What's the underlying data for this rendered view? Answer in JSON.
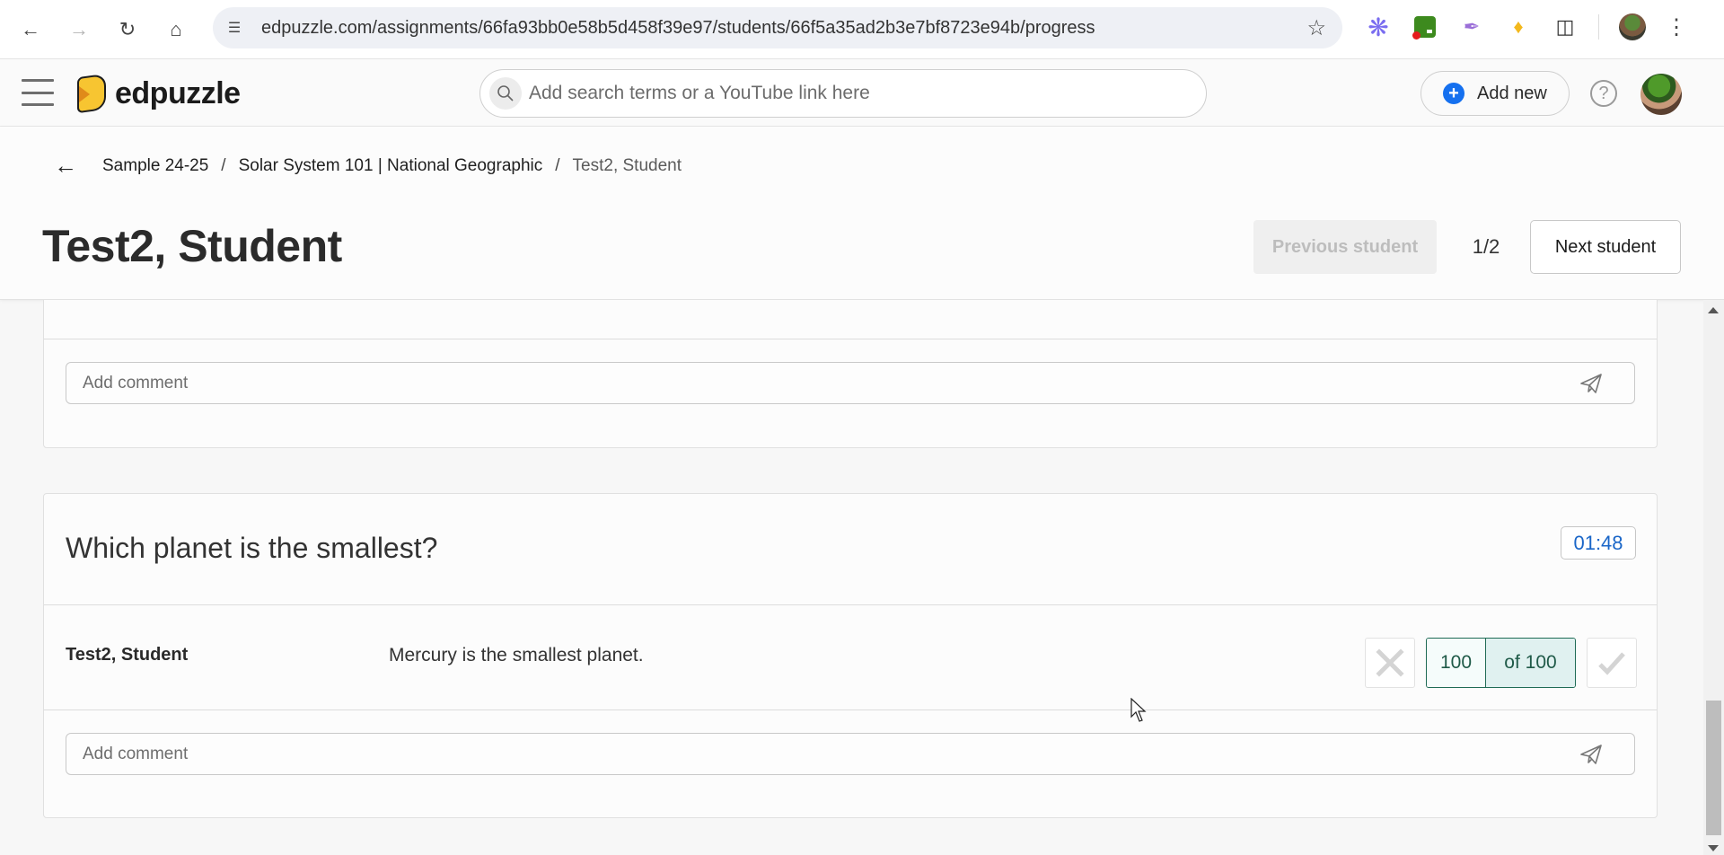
{
  "browser": {
    "url": "edpuzzle.com/assignments/66fa93bb0e58b5d458f39e97/students/66f5a35ad2b3e7bf8723e94b/progress",
    "icons": {
      "back": "back-arrow-icon",
      "forward": "forward-arrow-icon",
      "reload": "reload-icon",
      "home": "home-icon",
      "site_info": "tune-icon",
      "bookmark": "star-icon",
      "extensions": [
        "sparkle-extension-icon",
        "green-extension-icon",
        "quill-extension-icon",
        "edpuzzle-extension-icon",
        "puzzle-extensions-icon"
      ],
      "menu": "kebab-menu-icon"
    }
  },
  "app_header": {
    "logo_text": "edpuzzle",
    "search": {
      "placeholder": "Add search terms or a YouTube link here",
      "value": ""
    },
    "add_new_label": "Add new",
    "help_label": "?",
    "accent_color": "#1570ef"
  },
  "page_header": {
    "breadcrumb": [
      {
        "label": "Sample 24-25"
      },
      {
        "label": "Solar System 101 | National Geographic"
      },
      {
        "label": "Test2, Student"
      }
    ],
    "separator": "/",
    "title": "Test2, Student",
    "prev_student_label": "Previous student",
    "pager": "1/2",
    "next_student_label": "Next student"
  },
  "cards": [
    {
      "comment": {
        "placeholder": "Add comment",
        "value": ""
      }
    },
    {
      "question": "Which planet is the smallest?",
      "timestamp": "01:48",
      "response": {
        "student": "Test2, Student",
        "answer": "Mercury is the smallest planet.",
        "score": "100",
        "score_total": "of 100"
      },
      "comment": {
        "placeholder": "Add comment",
        "value": ""
      }
    }
  ],
  "colors": {
    "timestamp": "#1a66c8",
    "score_border": "#1f6b55",
    "score_total_bg": "#e0f1f0"
  }
}
